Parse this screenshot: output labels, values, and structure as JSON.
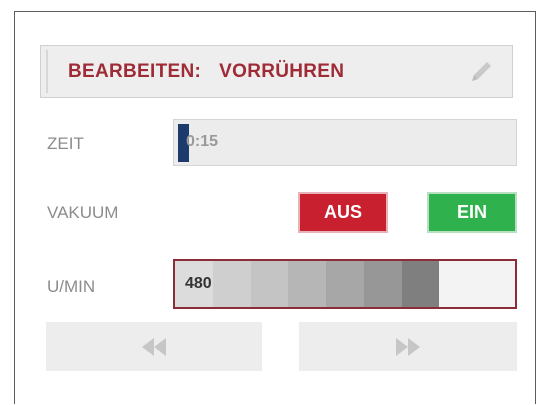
{
  "edit": {
    "prefix": "BEARBEITEN:",
    "program": "VORRÜHREN",
    "icon": "pencil-icon"
  },
  "time": {
    "label": "ZEIT",
    "value": "0:15"
  },
  "vacuum": {
    "label": "VAKUUM",
    "off_label": "AUS",
    "on_label": "EIN",
    "off_color": "#c8202e",
    "on_color": "#2fb14d"
  },
  "rpm": {
    "label": "U/MIN",
    "value": "480",
    "segments_filled": 7,
    "segments_total": 9,
    "segment_colors": [
      "#dcdcdc",
      "#cfcfcf",
      "#c4c4c4",
      "#b6b6b6",
      "#a7a7a7",
      "#979797",
      "#7f7f7f"
    ]
  },
  "nav": {
    "prev_icon": "rewind-icon",
    "next_icon": "fast-forward-icon"
  }
}
